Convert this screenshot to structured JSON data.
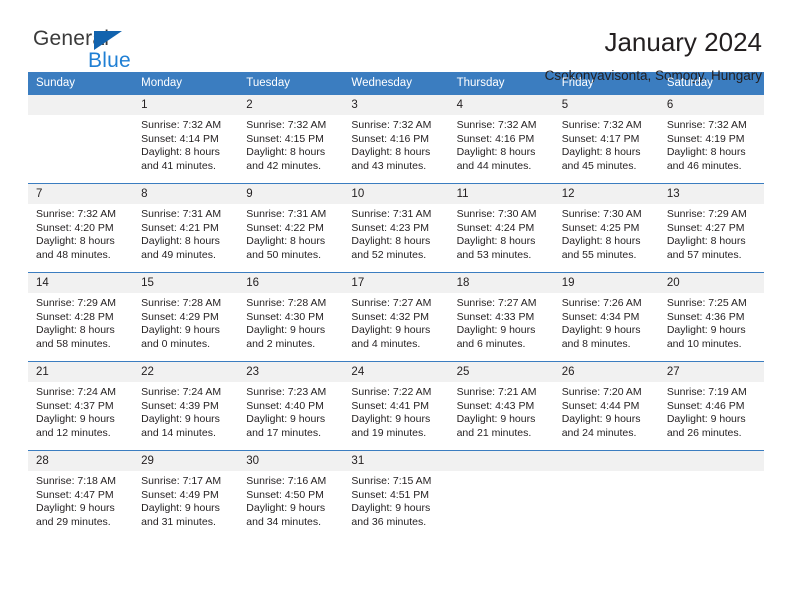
{
  "brand": {
    "name_part1": "General",
    "name_part2": "Blue",
    "triangle_color": "#1263ae",
    "blue_color": "#1f7fd4"
  },
  "header": {
    "title": "January 2024",
    "subtitle": "Csokonyavisonta, Somogy, Hungary"
  },
  "theme": {
    "header_bg": "#3b7dc0",
    "daynum_bg": "#f1f1f1",
    "text": "#231f20"
  },
  "calendar": {
    "weekday_headers": [
      "Sunday",
      "Monday",
      "Tuesday",
      "Wednesday",
      "Thursday",
      "Friday",
      "Saturday"
    ],
    "weeks": [
      [
        {
          "day": "",
          "lines": []
        },
        {
          "day": "1",
          "lines": [
            "Sunrise: 7:32 AM",
            "Sunset: 4:14 PM",
            "Daylight: 8 hours",
            "and 41 minutes."
          ]
        },
        {
          "day": "2",
          "lines": [
            "Sunrise: 7:32 AM",
            "Sunset: 4:15 PM",
            "Daylight: 8 hours",
            "and 42 minutes."
          ]
        },
        {
          "day": "3",
          "lines": [
            "Sunrise: 7:32 AM",
            "Sunset: 4:16 PM",
            "Daylight: 8 hours",
            "and 43 minutes."
          ]
        },
        {
          "day": "4",
          "lines": [
            "Sunrise: 7:32 AM",
            "Sunset: 4:16 PM",
            "Daylight: 8 hours",
            "and 44 minutes."
          ]
        },
        {
          "day": "5",
          "lines": [
            "Sunrise: 7:32 AM",
            "Sunset: 4:17 PM",
            "Daylight: 8 hours",
            "and 45 minutes."
          ]
        },
        {
          "day": "6",
          "lines": [
            "Sunrise: 7:32 AM",
            "Sunset: 4:19 PM",
            "Daylight: 8 hours",
            "and 46 minutes."
          ]
        }
      ],
      [
        {
          "day": "7",
          "lines": [
            "Sunrise: 7:32 AM",
            "Sunset: 4:20 PM",
            "Daylight: 8 hours",
            "and 48 minutes."
          ]
        },
        {
          "day": "8",
          "lines": [
            "Sunrise: 7:31 AM",
            "Sunset: 4:21 PM",
            "Daylight: 8 hours",
            "and 49 minutes."
          ]
        },
        {
          "day": "9",
          "lines": [
            "Sunrise: 7:31 AM",
            "Sunset: 4:22 PM",
            "Daylight: 8 hours",
            "and 50 minutes."
          ]
        },
        {
          "day": "10",
          "lines": [
            "Sunrise: 7:31 AM",
            "Sunset: 4:23 PM",
            "Daylight: 8 hours",
            "and 52 minutes."
          ]
        },
        {
          "day": "11",
          "lines": [
            "Sunrise: 7:30 AM",
            "Sunset: 4:24 PM",
            "Daylight: 8 hours",
            "and 53 minutes."
          ]
        },
        {
          "day": "12",
          "lines": [
            "Sunrise: 7:30 AM",
            "Sunset: 4:25 PM",
            "Daylight: 8 hours",
            "and 55 minutes."
          ]
        },
        {
          "day": "13",
          "lines": [
            "Sunrise: 7:29 AM",
            "Sunset: 4:27 PM",
            "Daylight: 8 hours",
            "and 57 minutes."
          ]
        }
      ],
      [
        {
          "day": "14",
          "lines": [
            "Sunrise: 7:29 AM",
            "Sunset: 4:28 PM",
            "Daylight: 8 hours",
            "and 58 minutes."
          ]
        },
        {
          "day": "15",
          "lines": [
            "Sunrise: 7:28 AM",
            "Sunset: 4:29 PM",
            "Daylight: 9 hours",
            "and 0 minutes."
          ]
        },
        {
          "day": "16",
          "lines": [
            "Sunrise: 7:28 AM",
            "Sunset: 4:30 PM",
            "Daylight: 9 hours",
            "and 2 minutes."
          ]
        },
        {
          "day": "17",
          "lines": [
            "Sunrise: 7:27 AM",
            "Sunset: 4:32 PM",
            "Daylight: 9 hours",
            "and 4 minutes."
          ]
        },
        {
          "day": "18",
          "lines": [
            "Sunrise: 7:27 AM",
            "Sunset: 4:33 PM",
            "Daylight: 9 hours",
            "and 6 minutes."
          ]
        },
        {
          "day": "19",
          "lines": [
            "Sunrise: 7:26 AM",
            "Sunset: 4:34 PM",
            "Daylight: 9 hours",
            "and 8 minutes."
          ]
        },
        {
          "day": "20",
          "lines": [
            "Sunrise: 7:25 AM",
            "Sunset: 4:36 PM",
            "Daylight: 9 hours",
            "and 10 minutes."
          ]
        }
      ],
      [
        {
          "day": "21",
          "lines": [
            "Sunrise: 7:24 AM",
            "Sunset: 4:37 PM",
            "Daylight: 9 hours",
            "and 12 minutes."
          ]
        },
        {
          "day": "22",
          "lines": [
            "Sunrise: 7:24 AM",
            "Sunset: 4:39 PM",
            "Daylight: 9 hours",
            "and 14 minutes."
          ]
        },
        {
          "day": "23",
          "lines": [
            "Sunrise: 7:23 AM",
            "Sunset: 4:40 PM",
            "Daylight: 9 hours",
            "and 17 minutes."
          ]
        },
        {
          "day": "24",
          "lines": [
            "Sunrise: 7:22 AM",
            "Sunset: 4:41 PM",
            "Daylight: 9 hours",
            "and 19 minutes."
          ]
        },
        {
          "day": "25",
          "lines": [
            "Sunrise: 7:21 AM",
            "Sunset: 4:43 PM",
            "Daylight: 9 hours",
            "and 21 minutes."
          ]
        },
        {
          "day": "26",
          "lines": [
            "Sunrise: 7:20 AM",
            "Sunset: 4:44 PM",
            "Daylight: 9 hours",
            "and 24 minutes."
          ]
        },
        {
          "day": "27",
          "lines": [
            "Sunrise: 7:19 AM",
            "Sunset: 4:46 PM",
            "Daylight: 9 hours",
            "and 26 minutes."
          ]
        }
      ],
      [
        {
          "day": "28",
          "lines": [
            "Sunrise: 7:18 AM",
            "Sunset: 4:47 PM",
            "Daylight: 9 hours",
            "and 29 minutes."
          ]
        },
        {
          "day": "29",
          "lines": [
            "Sunrise: 7:17 AM",
            "Sunset: 4:49 PM",
            "Daylight: 9 hours",
            "and 31 minutes."
          ]
        },
        {
          "day": "30",
          "lines": [
            "Sunrise: 7:16 AM",
            "Sunset: 4:50 PM",
            "Daylight: 9 hours",
            "and 34 minutes."
          ]
        },
        {
          "day": "31",
          "lines": [
            "Sunrise: 7:15 AM",
            "Sunset: 4:51 PM",
            "Daylight: 9 hours",
            "and 36 minutes."
          ]
        },
        {
          "day": "",
          "lines": []
        },
        {
          "day": "",
          "lines": []
        },
        {
          "day": "",
          "lines": []
        }
      ]
    ]
  }
}
